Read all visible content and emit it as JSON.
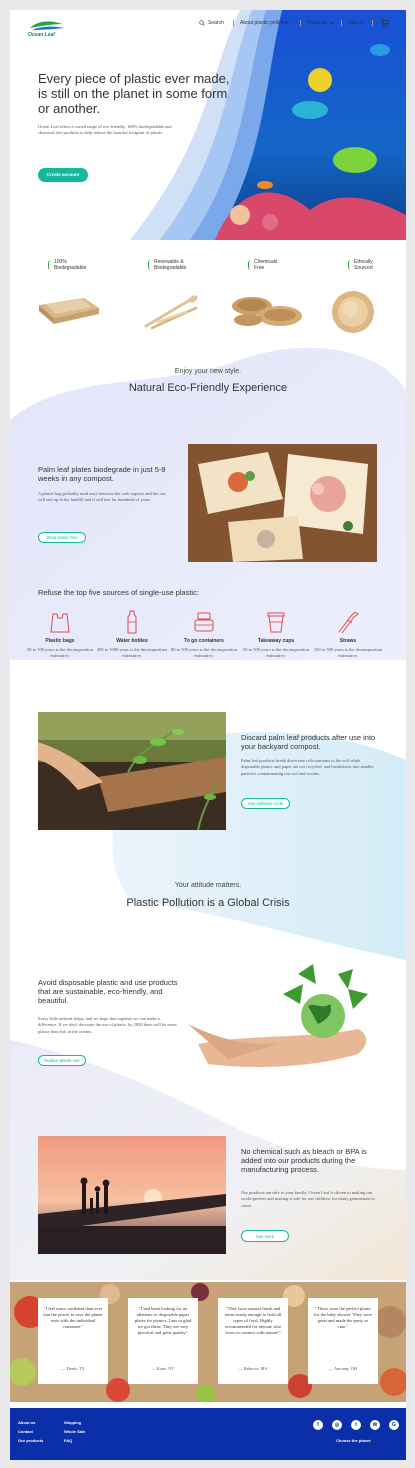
{
  "brand": {
    "name": "Ocean Leaf"
  },
  "nav": {
    "search": "Search",
    "about": "About plastic pollution",
    "products": "Products",
    "signin": "Sign In",
    "cart_icon": "cart-icon",
    "search_icon": "search-icon"
  },
  "hero": {
    "title": "Every piece of plastic ever made, is still on the planet in some form or another.",
    "description": "Ocean Leaf offers a varied range of eco-friendly, 100% biodegradable and chemical free products to help reduce the harmful footprint of plastic.",
    "cta": "Create account"
  },
  "features": [
    {
      "line1": "100%",
      "line2": "Biodegradable"
    },
    {
      "line1": "Renewable &",
      "line2": "Biodegradable"
    },
    {
      "line1": "Chemicals",
      "line2": "Free"
    },
    {
      "line1": "Ethically",
      "line2": "Sourced"
    }
  ],
  "experience": {
    "subtitle": "Enjoy your new style.",
    "title": "Natural Eco-Friendly Experience"
  },
  "palm_plates": {
    "title": "Palm leaf plates biodegrade in just 5-8 weeks in any compost.",
    "text": "A plastic bag probably used once between the cash register and the car, will end up in the landfill and it will last for hundreds of years.",
    "button": "Shop plastic free"
  },
  "sources": {
    "title": "Refuse the top five sources of single-use plastic:",
    "items": [
      {
        "name": "Plastic bags",
        "years": "30 to 100 years is the decomposition estimative."
      },
      {
        "name": "Water bottles",
        "years": "450 to 1000 years is the decomposition estimative."
      },
      {
        "name": "To go containers",
        "years": "80 to 500 years is the decomposition estimative."
      },
      {
        "name": "Takeaway cups",
        "years": "50 to 500 years is the decomposition estimative."
      },
      {
        "name": "Straws",
        "years": "100 to 500 years is the decomposition estimative."
      }
    ]
  },
  "compost": {
    "title": "Discard palm leaf products after use into your backyard compost.",
    "text": "Palm leaf products break down into rich nutrients to the soil while disposable plastic and paper are not recycled, and breakdown into smaller particles contaminating our soil and oceans.",
    "button": "See pollution cycle"
  },
  "crisis": {
    "subtitle": "Your attitude matters.",
    "title": "Plastic Pollution is a Global Crisis"
  },
  "avoid": {
    "title": "Avoid disposable plastic and use products that are sustainable, eco-friendly, and beautiful.",
    "text": "Every little attitude helps, and we hope that together we can make a difference. If we don't decrease the use of plastic, by 2050 there will be more plastic than fish in the oceans.",
    "button": "Reduce plastic use"
  },
  "chemical": {
    "title": "No chemical such as bleach or BPA is added into our products during the manufacturing process.",
    "text": "Our products are safe to your family. Ocean Leaf is driven to making our world greener and making it safe for our children, for many generations to come.",
    "button": "See more"
  },
  "testimonials": [
    {
      "quote": "\"I feel more confident than ever that the power to save the planet rests with the individual consumer.\"",
      "author": "— Denis, TX"
    },
    {
      "quote": "\"I had been looking for an alternate to disposable paper plates for picnics. I am so glad we got these. They are very practical and great quality.\"",
      "author": "— Katie, NY"
    },
    {
      "quote": "\"They have natural finish and seem sturdy enough to hold all types of food. Highly recommended for anyone who loves to connect with nature!\"",
      "author": "— Rebecca, MA"
    },
    {
      "quote": "\"These were the perfect plates for the baby shower. They were great and made the party so cute.\"",
      "author": "— Antonny, OH"
    }
  ],
  "footer": {
    "col1": [
      "About us",
      "Contact",
      "Our products"
    ],
    "col2": [
      "Shipping",
      "Whole Sale",
      "FAQ"
    ],
    "social": [
      "facebook-icon",
      "instagram-icon",
      "twitter-icon",
      "email-icon",
      "google-plus-icon"
    ],
    "tagline": "Choose the planet"
  },
  "colors": {
    "accent": "#14b89a",
    "footer": "#0b2fa8",
    "leaf": "#2aa24a"
  }
}
